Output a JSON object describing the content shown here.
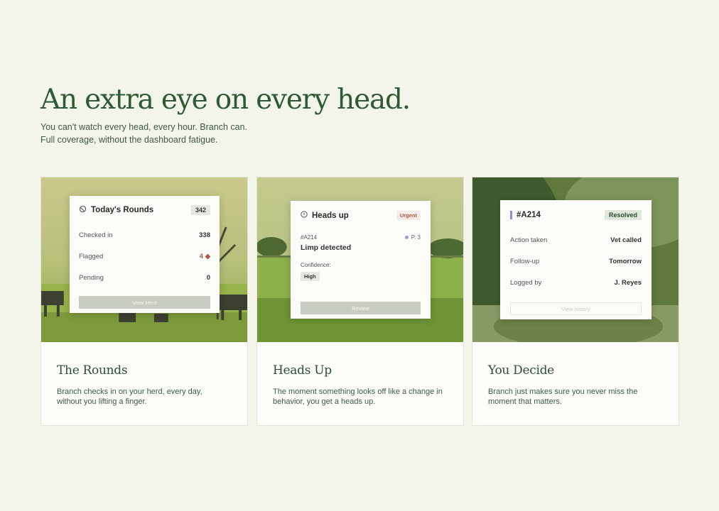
{
  "hero": {
    "title": "An extra eye on every head.",
    "subtitle_line1": "You can't watch every head, every hour. Branch can.",
    "subtitle_line2": "Full coverage, without the dashboard fatigue."
  },
  "cards": [
    {
      "title": "The Rounds",
      "description": "Branch checks in on your herd, every day, without you lifting a finger.",
      "panel": {
        "title": "Today's Rounds",
        "count": "342",
        "rows": [
          {
            "label": "Checked in",
            "value": "338"
          },
          {
            "label": "Flagged",
            "value": "4"
          },
          {
            "label": "Pending",
            "value": "0"
          }
        ],
        "button": "View Herd"
      }
    },
    {
      "title": "Heads Up",
      "description": "The moment something looks off like a change in behavior, you get a heads up.",
      "panel": {
        "title": "Heads up",
        "badge": "Urgent",
        "animal_id": "#A214",
        "priority": "P. 3",
        "issue": "Limp detected",
        "confidence_label": "Confidence:",
        "confidence": "High",
        "button": "Review"
      }
    },
    {
      "title": "You Decide",
      "description": "Branch just makes sure you never miss the moment that matters.",
      "panel": {
        "title": "#A214",
        "badge": "Resolved",
        "rows": [
          {
            "label": "Action taken",
            "value": "Vet called"
          },
          {
            "label": "Follow-up",
            "value": "Tomorrow"
          },
          {
            "label": "Logged by",
            "value": "J. Reyes"
          }
        ],
        "button": "View history"
      }
    }
  ],
  "colors": {
    "background": "#f3f4ea",
    "heading": "#2e5a36",
    "flag": "#b0584a",
    "urgent": "#b05a45",
    "priority_dot": "#9b9ed6"
  }
}
